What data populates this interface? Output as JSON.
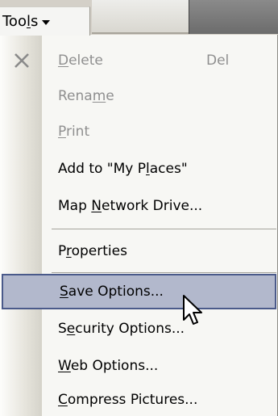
{
  "toolbar": {
    "tools_label_before": "Too",
    "tools_label_mnemonic": "l",
    "tools_label_after": "s"
  },
  "menu": {
    "items": [
      {
        "before": "",
        "mnemonic": "D",
        "after": "elete",
        "shortcut": "Del",
        "icon": "delete-x-icon",
        "state": "disabled"
      },
      {
        "before": "Rena",
        "mnemonic": "m",
        "after": "e",
        "shortcut": "",
        "state": "disabled"
      },
      {
        "before": "",
        "mnemonic": "P",
        "after": "rint",
        "shortcut": "",
        "state": "disabled"
      },
      {
        "before": "Add to \"My P",
        "mnemonic": "l",
        "after": "aces\"",
        "shortcut": "",
        "state": "enabled"
      },
      {
        "before": "Map ",
        "mnemonic": "N",
        "after": "etwork Drive...",
        "shortcut": "",
        "state": "enabled"
      },
      {
        "before": "P",
        "mnemonic": "r",
        "after": "operties",
        "shortcut": "",
        "state": "enabled"
      },
      {
        "before": "",
        "mnemonic": "S",
        "after": "ave Options...",
        "shortcut": "",
        "state": "highlighted"
      },
      {
        "before": "S",
        "mnemonic": "e",
        "after": "curity Options...",
        "shortcut": "",
        "state": "enabled"
      },
      {
        "before": "",
        "mnemonic": "W",
        "after": "eb Options...",
        "shortcut": "",
        "state": "enabled"
      },
      {
        "before": "",
        "mnemonic": "C",
        "after": "ompress Pictures...",
        "shortcut": "",
        "state": "enabled"
      }
    ]
  },
  "colors": {
    "highlight_fill": "#b2b8cc",
    "highlight_border": "#4a5a8a",
    "disabled_text": "#8f8f8f"
  },
  "cursor": {
    "icon": "arrow-cursor-icon"
  }
}
